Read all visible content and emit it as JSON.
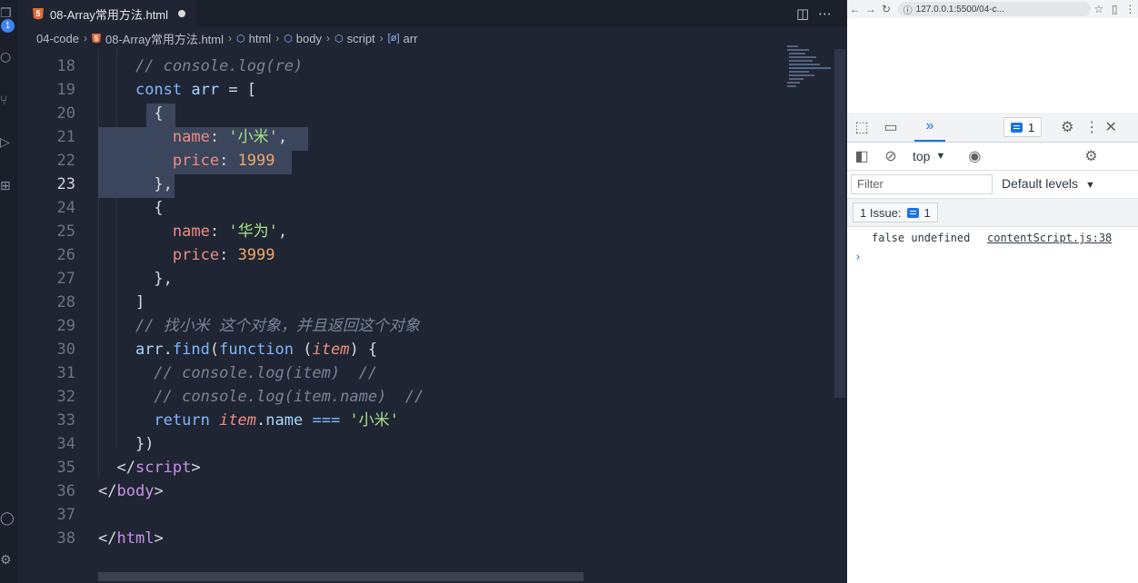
{
  "editor": {
    "tab": {
      "label": "08-Array常用方法.html",
      "icon": "html5-icon",
      "dirty": true
    },
    "activity_badge": "1",
    "breadcrumb": {
      "folder": "04-code",
      "file": "08-Array常用方法.html",
      "html": "html",
      "body": "body",
      "script": "script",
      "arr": "arr"
    },
    "active_line": 23,
    "lines": [
      {
        "n": "18",
        "tokens": [
          [
            "cm",
            "// console.log(re)"
          ]
        ],
        "indent": "    "
      },
      {
        "n": "19",
        "tokens": [
          [
            "kw",
            "const "
          ],
          [
            "id",
            "arr"
          ],
          [
            "pu",
            " = ["
          ]
        ],
        "indent": "    "
      },
      {
        "n": "20",
        "tokens": [
          [
            "pu",
            "{"
          ]
        ],
        "indent": "      "
      },
      {
        "n": "21",
        "tokens": [
          [
            "prop",
            "name"
          ],
          [
            "pu",
            ": "
          ],
          [
            "str",
            "'小米'"
          ],
          [
            "pu",
            ","
          ]
        ],
        "indent": "        "
      },
      {
        "n": "22",
        "tokens": [
          [
            "prop",
            "price"
          ],
          [
            "pu",
            ": "
          ],
          [
            "num",
            "1999"
          ]
        ],
        "indent": "        "
      },
      {
        "n": "23",
        "tokens": [
          [
            "pu",
            "},"
          ]
        ],
        "indent": "      "
      },
      {
        "n": "24",
        "tokens": [
          [
            "pu",
            "{"
          ]
        ],
        "indent": "      "
      },
      {
        "n": "25",
        "tokens": [
          [
            "prop",
            "name"
          ],
          [
            "pu",
            ": "
          ],
          [
            "str",
            "'华为'"
          ],
          [
            "pu",
            ","
          ]
        ],
        "indent": "        "
      },
      {
        "n": "26",
        "tokens": [
          [
            "prop",
            "price"
          ],
          [
            "pu",
            ": "
          ],
          [
            "num",
            "3999"
          ]
        ],
        "indent": "        "
      },
      {
        "n": "27",
        "tokens": [
          [
            "pu",
            "},"
          ]
        ],
        "indent": "      "
      },
      {
        "n": "28",
        "tokens": [
          [
            "pu",
            "]"
          ]
        ],
        "indent": "    "
      },
      {
        "n": "29",
        "tokens": [
          [
            "cm",
            "// 找小米 这个对象，并且返回这个对象"
          ]
        ],
        "indent": "    "
      },
      {
        "n": "30",
        "tokens": [
          [
            "id",
            "arr"
          ],
          [
            "pu",
            "."
          ],
          [
            "fn",
            "find"
          ],
          [
            "pu",
            "("
          ],
          [
            "kw",
            "function"
          ],
          [
            "pu",
            " ("
          ],
          [
            "param",
            "item"
          ],
          [
            "pu",
            ") {"
          ]
        ],
        "indent": "    "
      },
      {
        "n": "31",
        "tokens": [
          [
            "cm",
            "// console.log(item)  //"
          ]
        ],
        "indent": "      "
      },
      {
        "n": "32",
        "tokens": [
          [
            "cm",
            "// console.log(item.name)  //"
          ]
        ],
        "indent": "      "
      },
      {
        "n": "33",
        "tokens": [
          [
            "kw",
            "return "
          ],
          [
            "param",
            "item"
          ],
          [
            "pu",
            "."
          ],
          [
            "id",
            "name"
          ],
          [
            "kw",
            " === "
          ],
          [
            "str",
            "'小米'"
          ]
        ],
        "indent": "      "
      },
      {
        "n": "34",
        "tokens": [
          [
            "pu",
            "})"
          ]
        ],
        "indent": "    "
      },
      {
        "n": "35",
        "tokens": [
          [
            "tag",
            "</"
          ],
          [
            "kwp",
            "script"
          ],
          [
            "tag",
            ">"
          ]
        ],
        "indent": "  "
      },
      {
        "n": "36",
        "tokens": [
          [
            "tag",
            "</"
          ],
          [
            "kwp",
            "body"
          ],
          [
            "tag",
            ">"
          ]
        ],
        "indent": ""
      },
      {
        "n": "37",
        "tokens": [],
        "indent": ""
      },
      {
        "n": "38",
        "tokens": [
          [
            "tag",
            "</"
          ],
          [
            "kwp",
            "html"
          ],
          [
            "tag",
            ">"
          ]
        ],
        "indent": ""
      }
    ]
  },
  "browser": {
    "address": "127.0.0.1:5500/04-c..."
  },
  "devtools": {
    "messages_count": "1",
    "context": "top",
    "filter_placeholder": "Filter",
    "levels": "Default levels",
    "issues_label": "1 Issue:",
    "issues_count": "1",
    "log": {
      "text": "false undefined",
      "source": "contentScript.js:38"
    },
    "prompt": "›"
  },
  "colors": {
    "editor_bg": "#1f2532",
    "accent": "#1a73e8"
  }
}
